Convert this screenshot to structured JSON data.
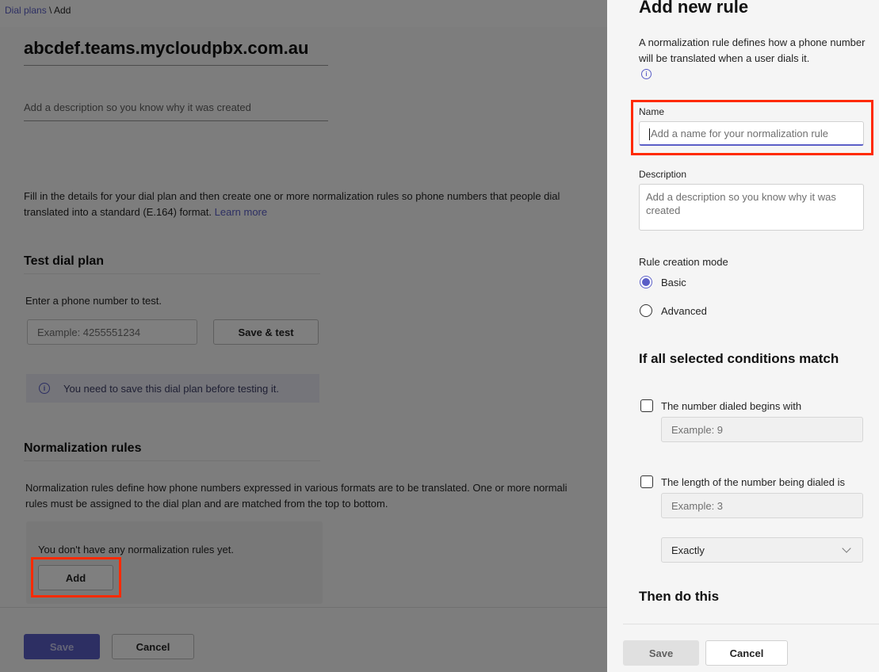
{
  "breadcrumb": {
    "parent": "Dial plans",
    "separator": " \\ ",
    "current": "Add"
  },
  "main": {
    "plan_name": "abcdef.teams.mycloudpbx.com.au",
    "description_placeholder": "Add a description so you know why it was created",
    "intro_line1": "Fill in the details for your dial plan and then create one or more normalization rules so phone numbers that people dial",
    "intro_line2": "translated into a standard (E.164) format. ",
    "learn_more": "Learn more",
    "test_section": {
      "title": "Test dial plan",
      "prompt": "Enter a phone number to test.",
      "input_placeholder": "Example: 4255551234",
      "button": "Save & test",
      "info_message": "You need to save this dial plan before testing it."
    },
    "normalization_section": {
      "title": "Normalization rules",
      "desc_line1": "Normalization rules define how phone numbers expressed in various formats are to be translated. One or more normali",
      "desc_line2": "rules must be assigned to the dial plan and are matched from the top to bottom.",
      "empty_message": "You don't have any normalization rules yet.",
      "add_button": "Add"
    },
    "footer": {
      "save": "Save",
      "cancel": "Cancel"
    }
  },
  "panel": {
    "title": "Add new rule",
    "description": "A normalization rule defines how a phone number will be translated when a user dials it.",
    "info_icon": "i",
    "name_label": "Name",
    "name_placeholder": "Add a name for your normalization rule",
    "description_label": "Description",
    "description_placeholder": "Add a description so you know why it was created",
    "mode_label": "Rule creation mode",
    "modes": [
      {
        "label": "Basic",
        "checked": true
      },
      {
        "label": "Advanced",
        "checked": false
      }
    ],
    "conditions_title": "If all selected conditions match",
    "condition_begins": {
      "label": "The number dialed begins with",
      "placeholder": "Example: 9",
      "checked": false
    },
    "condition_length": {
      "label": "The length of the number being dialed is",
      "placeholder": "Example: 3",
      "checked": false,
      "select_value": "Exactly"
    },
    "then_title": "Then do this",
    "footer": {
      "save": "Save",
      "cancel": "Cancel"
    }
  },
  "colors": {
    "accent": "#5b5fc7",
    "highlight": "#ff2a00"
  }
}
